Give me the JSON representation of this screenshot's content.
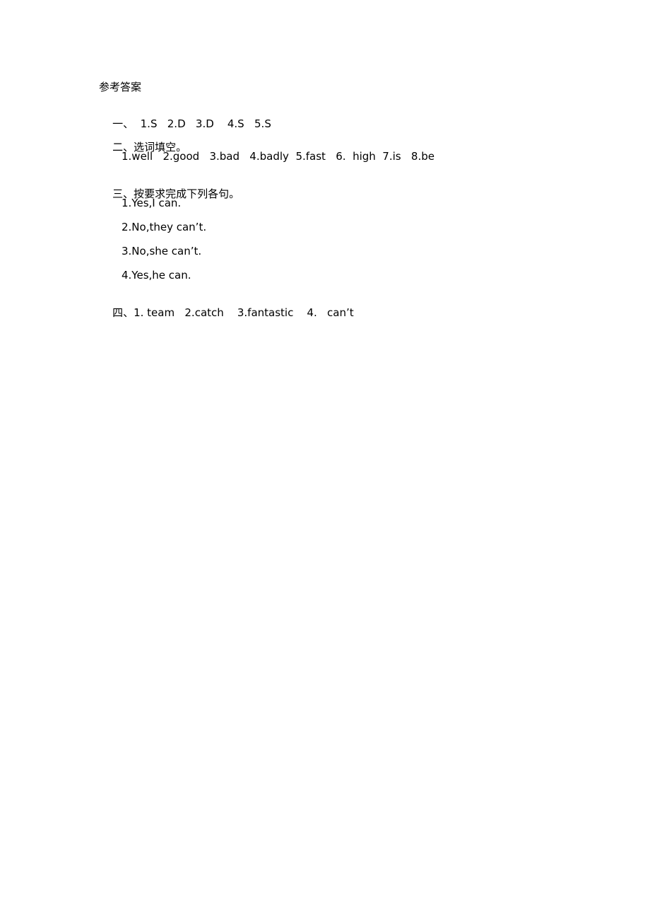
{
  "document": {
    "title": "参考答案",
    "sections": [
      {
        "label": "一、",
        "answers_text": "  1.S   2.D   3.D    4.S   5.S"
      },
      {
        "label": "二、",
        "heading": "选词填空。",
        "answers_text": "1.well   2.good   3.bad   4.badly  5.fast   6.  high  7.is   8.be"
      },
      {
        "label": "三、",
        "heading": "按要求完成下列各句。",
        "items": [
          "1.Yes,I can.",
          "2.No,they can’t.",
          "3.No,she can’t.",
          "4.Yes,he can."
        ]
      },
      {
        "label": "四、",
        "answers_text": "1. team   2.catch    3.fantastic    4.   can’t"
      }
    ]
  }
}
